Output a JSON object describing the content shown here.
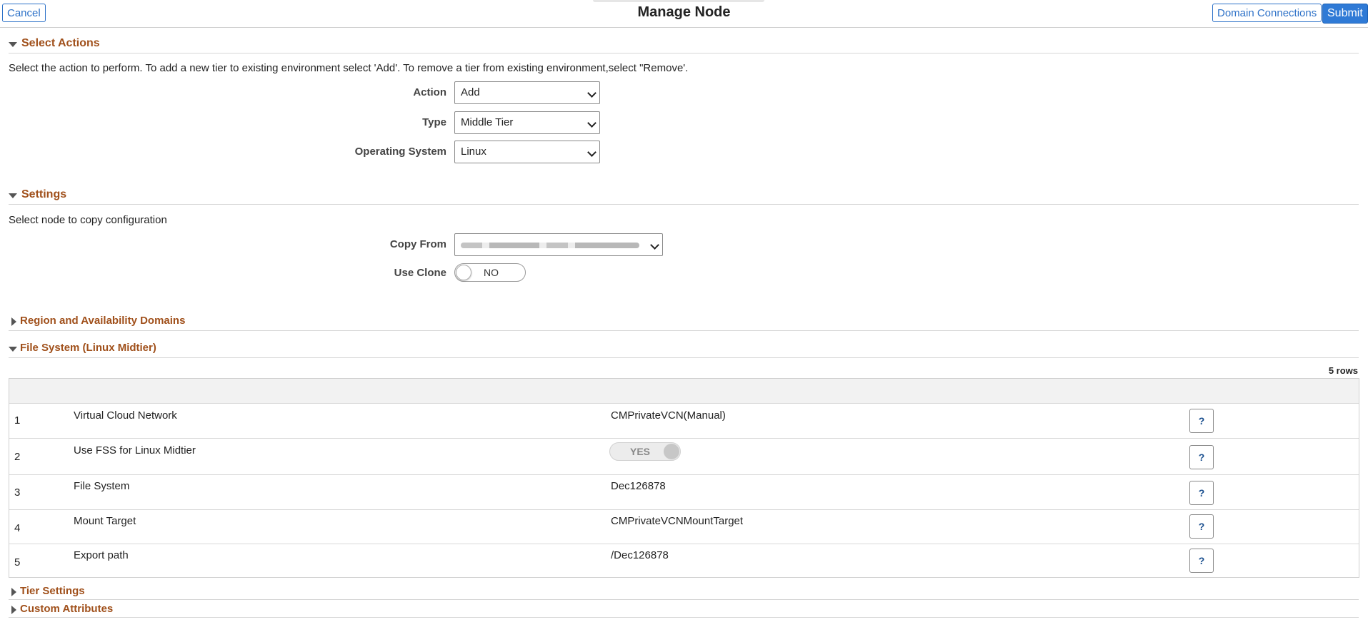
{
  "header": {
    "title": "Manage Node",
    "cancel_label": "Cancel",
    "domain_connections_label": "Domain Connections",
    "submit_label": "Submit"
  },
  "select_actions": {
    "title": "Select Actions",
    "description": "Select the action to perform. To add a new tier to existing environment select 'Add'. To remove a tier from existing environment,select \"Remove'.",
    "fields": [
      {
        "label": "Action",
        "value": "Add"
      },
      {
        "label": "Type",
        "value": "Middle Tier"
      },
      {
        "label": "Operating System",
        "value": "Linux"
      }
    ]
  },
  "settings": {
    "title": "Settings",
    "description": "Select node to copy configuration",
    "copy_from_label": "Copy From",
    "use_clone_label": "Use Clone",
    "use_clone_value": "NO"
  },
  "region_section": {
    "title": "Region and Availability Domains"
  },
  "file_system": {
    "title": "File System (Linux Midtier)",
    "row_count": "5 rows",
    "help_label": "?",
    "rows": [
      {
        "num": "1",
        "name": "Virtual Cloud Network",
        "value": "CMPrivateVCN(Manual)"
      },
      {
        "num": "2",
        "name": "Use FSS for Linux Midtier",
        "value": "YES"
      },
      {
        "num": "3",
        "name": "File System",
        "value": "Dec126878"
      },
      {
        "num": "4",
        "name": "Mount Target",
        "value": "CMPrivateVCNMountTarget"
      },
      {
        "num": "5",
        "name": "Export path",
        "value": "/Dec126878"
      }
    ]
  },
  "tier_settings": {
    "title": "Tier Settings"
  },
  "custom_attributes": {
    "title": "Custom Attributes"
  },
  "colors": {
    "section_title": "#a0501b",
    "primary": "#2f7ad6",
    "link": "#2e72c8"
  },
  "icons": {
    "expanded": "triangle-down-icon",
    "collapsed": "triangle-right-icon",
    "select": "chevron-down-icon"
  }
}
